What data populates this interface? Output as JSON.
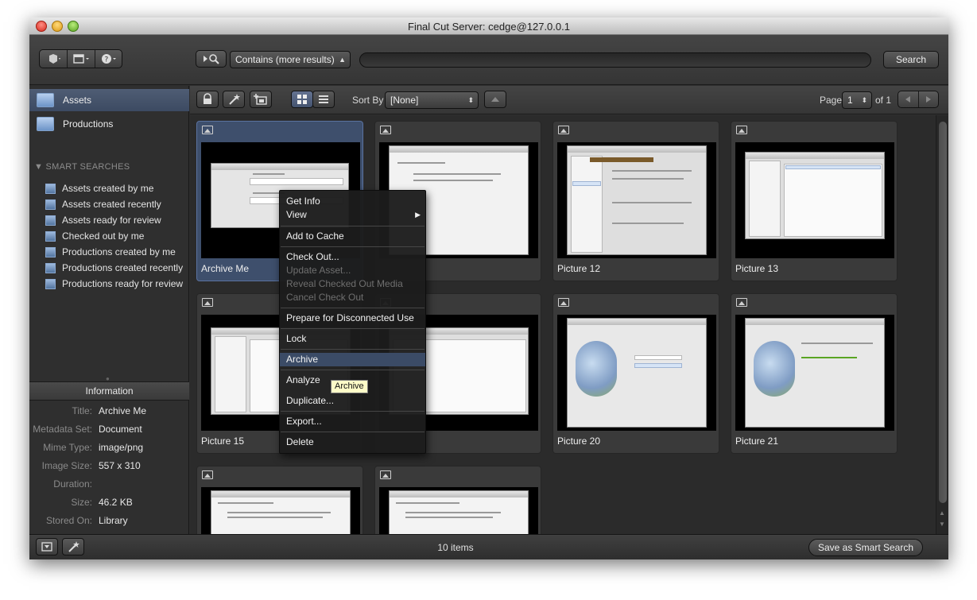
{
  "window": {
    "title": "Final Cut Server: cedge@127.0.0.1"
  },
  "toolbar": {
    "search_mode": "Contains (more results)",
    "search_value": "",
    "search_button": "Search"
  },
  "sidebar": {
    "nav": [
      {
        "label": "Assets",
        "icon": "assets-icon",
        "selected": true
      },
      {
        "label": "Productions",
        "icon": "productions-icon",
        "selected": false
      }
    ],
    "smart_searches_header": "SMART SEARCHES",
    "smart_searches": [
      "Assets created by me",
      "Assets created recently",
      "Assets ready for review",
      "Checked out by me",
      "Productions created by me",
      "Productions created recently",
      "Productions ready for review"
    ],
    "info_header": "Information",
    "info": [
      {
        "key": "Title:",
        "value": "Archive Me"
      },
      {
        "key": "Metadata Set:",
        "value": "Document"
      },
      {
        "key": "Mime Type:",
        "value": "image/png"
      },
      {
        "key": "Image Size:",
        "value": "557 x 310"
      },
      {
        "key": "Duration:",
        "value": ""
      },
      {
        "key": "Size:",
        "value": "46.2 KB"
      },
      {
        "key": "Stored On:",
        "value": "Library"
      }
    ]
  },
  "content": {
    "sort_by_label": "Sort By",
    "sort_by_value": "[None]",
    "page_label": "Page",
    "page_value": "1",
    "page_total": "of 1",
    "tiles": [
      {
        "name": "Archive Me",
        "selected": true
      },
      {
        "name": "",
        "selected": false
      },
      {
        "name": "Picture 12",
        "selected": false
      },
      {
        "name": "Picture 13",
        "selected": false
      },
      {
        "name": "Picture 15",
        "selected": false
      },
      {
        "name": "",
        "selected": false
      },
      {
        "name": "Picture 20",
        "selected": false
      },
      {
        "name": "Picture 21",
        "selected": false
      },
      {
        "name": "",
        "selected": false
      },
      {
        "name": "",
        "selected": false
      }
    ]
  },
  "status": {
    "items_count": "10 items",
    "save_smart_search": "Save as Smart Search"
  },
  "context_menu": {
    "items": [
      {
        "label": "Get Info",
        "disabled": false
      },
      {
        "label": "View",
        "disabled": false,
        "submenu": true
      },
      {
        "label": "Add to Cache",
        "disabled": false
      },
      {
        "label": "Check Out...",
        "disabled": false
      },
      {
        "label": "Update Asset...",
        "disabled": true
      },
      {
        "label": "Reveal Checked Out Media",
        "disabled": true
      },
      {
        "label": "Cancel Check Out",
        "disabled": true
      },
      {
        "label": "Prepare for Disconnected Use",
        "disabled": false
      },
      {
        "label": "Lock",
        "disabled": false
      },
      {
        "label": "Archive",
        "disabled": false,
        "highlighted": true
      },
      {
        "label": "Analyze",
        "disabled": false
      },
      {
        "label": "Duplicate...",
        "disabled": false
      },
      {
        "label": "Export...",
        "disabled": false
      },
      {
        "label": "Delete",
        "disabled": false
      }
    ],
    "tooltip": "Archive"
  }
}
